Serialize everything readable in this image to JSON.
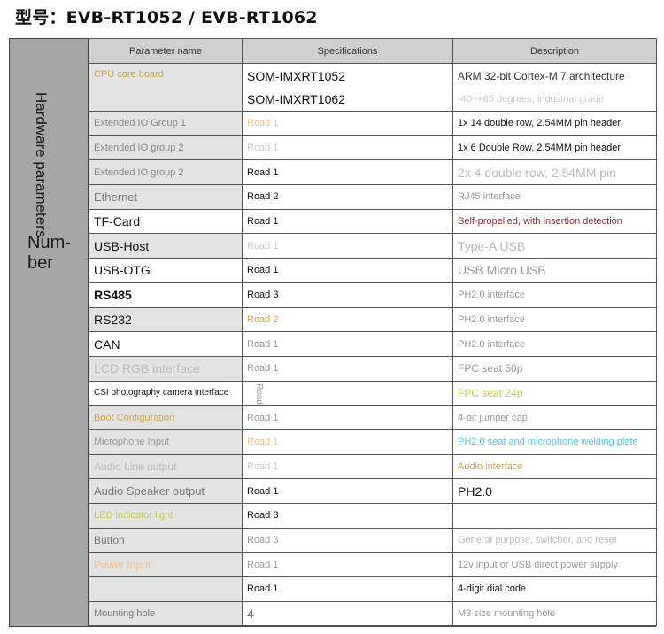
{
  "title": "型号：EVB-RT1052 / EVB-RT1062",
  "side": {
    "vertical_label": "Hardware parameters",
    "number_label": "Num-\nber"
  },
  "headers": {
    "param": "Parameter name",
    "spec": "Specifications",
    "desc": "Description"
  },
  "rows": [
    {
      "param": "CPU core board",
      "spec": [
        "SOM-IMXRT1052",
        "SOM-IMXRT1062"
      ],
      "desc": [
        "ARM 32-bit Cortex-M 7 architecture",
        "-40~+85 degrees, industrial grade"
      ]
    },
    {
      "param": "Extended IO Group 1",
      "spec": "Road 1",
      "desc": "1x 14 double row, 2.54MM pin header"
    },
    {
      "param": "Extended IO group 2",
      "spec": "Road 1",
      "desc": "1x 6 Double Row, 2.54MM pin header"
    },
    {
      "param": "Extended IO group 2",
      "spec": "Road 1",
      "desc": "2x 4 double row, 2.54MM pin"
    },
    {
      "param": "Ethernet",
      "spec": "Road 2",
      "desc": "RJ45 interface"
    },
    {
      "param": "TF-Card",
      "spec": "Road 1",
      "desc": "Self-propelled, with insertion detection"
    },
    {
      "param": "USB-Host",
      "spec": "Road 1",
      "desc": "Type-A USB"
    },
    {
      "param": "USB-OTG",
      "spec": "Road 1",
      "desc": "USB Micro USB"
    },
    {
      "param": "RS485",
      "spec": "Road 3",
      "desc": "PH2.0 interface"
    },
    {
      "param": "RS232",
      "spec": "Road 2",
      "desc": "PH2.0 interface"
    },
    {
      "param": "CAN",
      "spec": "Road 1",
      "desc": "PH2.0 interface"
    },
    {
      "param": "LCD RGB interface",
      "spec": "Road 1",
      "desc": "FPC seat 50p"
    },
    {
      "param": "CSI photography camera interface",
      "spec": "Road",
      "desc": "FPC seat 24p"
    },
    {
      "param": "Boot Configuration",
      "spec": "Road 1",
      "desc": "4-bit jumper cap"
    },
    {
      "param": "Microphone Input",
      "spec": "Road 1",
      "desc": "PH2.0 seat and microphone welding plate"
    },
    {
      "param": "Audio Line output",
      "spec": "Road 1",
      "desc": "Audio interface"
    },
    {
      "param": "Audio Speaker output",
      "spec": "Road 1",
      "desc": "PH2.0"
    },
    {
      "param": "LED indicator light",
      "spec": "Road 3",
      "desc": ""
    },
    {
      "param": "Button",
      "spec": "Road 3",
      "desc": "General purpose, switcher, and reset"
    },
    {
      "param": "Power Input",
      "spec": "Road 1",
      "desc": "12v input or USB direct power supply"
    },
    {
      "param": "",
      "spec": "Road 1",
      "desc": "4-digit dial code"
    },
    {
      "param": "Mounting hole",
      "spec": "4",
      "desc": "M3 size mounting hole"
    }
  ]
}
